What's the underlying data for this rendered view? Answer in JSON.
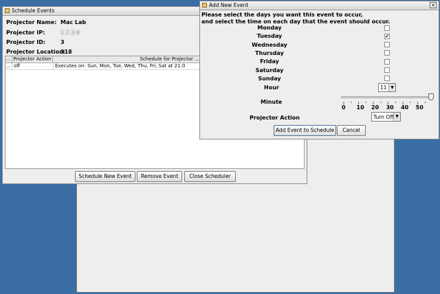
{
  "background_window": {},
  "schedule_window": {
    "title": "Schedule Events",
    "fields": [
      {
        "label": "Projector Name:",
        "value": "Mac Lab"
      },
      {
        "label": "Projector IP:",
        "value": "1.2.3.4"
      },
      {
        "label": "Projector ID:",
        "value": "3"
      },
      {
        "label": "Projector Location:",
        "value": "318"
      }
    ],
    "table": {
      "columns": [
        "...",
        "Projector Action",
        "Schedule for Projector ...\""
      ],
      "rows": [
        {
          "c0": "...",
          "action": "off",
          "schedule": "Executes on: Sun, Mon, Tue, Wed, Thu, Fri, Sat at 21:0"
        }
      ]
    },
    "buttons": {
      "schedule": "Schedule New Event",
      "remove": "Remove Event",
      "close": "Close Scheduler"
    }
  },
  "add_event_window": {
    "title": "Add New Event",
    "close_glyph": "✕",
    "instructions_1": "Please select the days you want this event to occur,",
    "instructions_2": "and select the time on each day that the event should occur.",
    "days": [
      {
        "label": "Monday",
        "checked": false
      },
      {
        "label": "Tuesday",
        "checked": true
      },
      {
        "label": "Wednesday",
        "checked": false
      },
      {
        "label": "Thursday",
        "checked": false
      },
      {
        "label": "Friday",
        "checked": false
      },
      {
        "label": "Saturday",
        "checked": false
      },
      {
        "label": "Sunday",
        "checked": false
      }
    ],
    "hour_label": "Hour",
    "hour_value": "11",
    "minute_label": "Minute",
    "minute_value": 59,
    "minute_ticks": [
      "0",
      "10",
      "20",
      "30",
      "40",
      "50"
    ],
    "action_label": "Projector Action",
    "action_value": "Turn Off",
    "buttons": {
      "add": "Add Event to Schedule",
      "cancel": "Cancel"
    }
  },
  "icons": {
    "checkmark": "✔",
    "dropdown": "▼"
  }
}
